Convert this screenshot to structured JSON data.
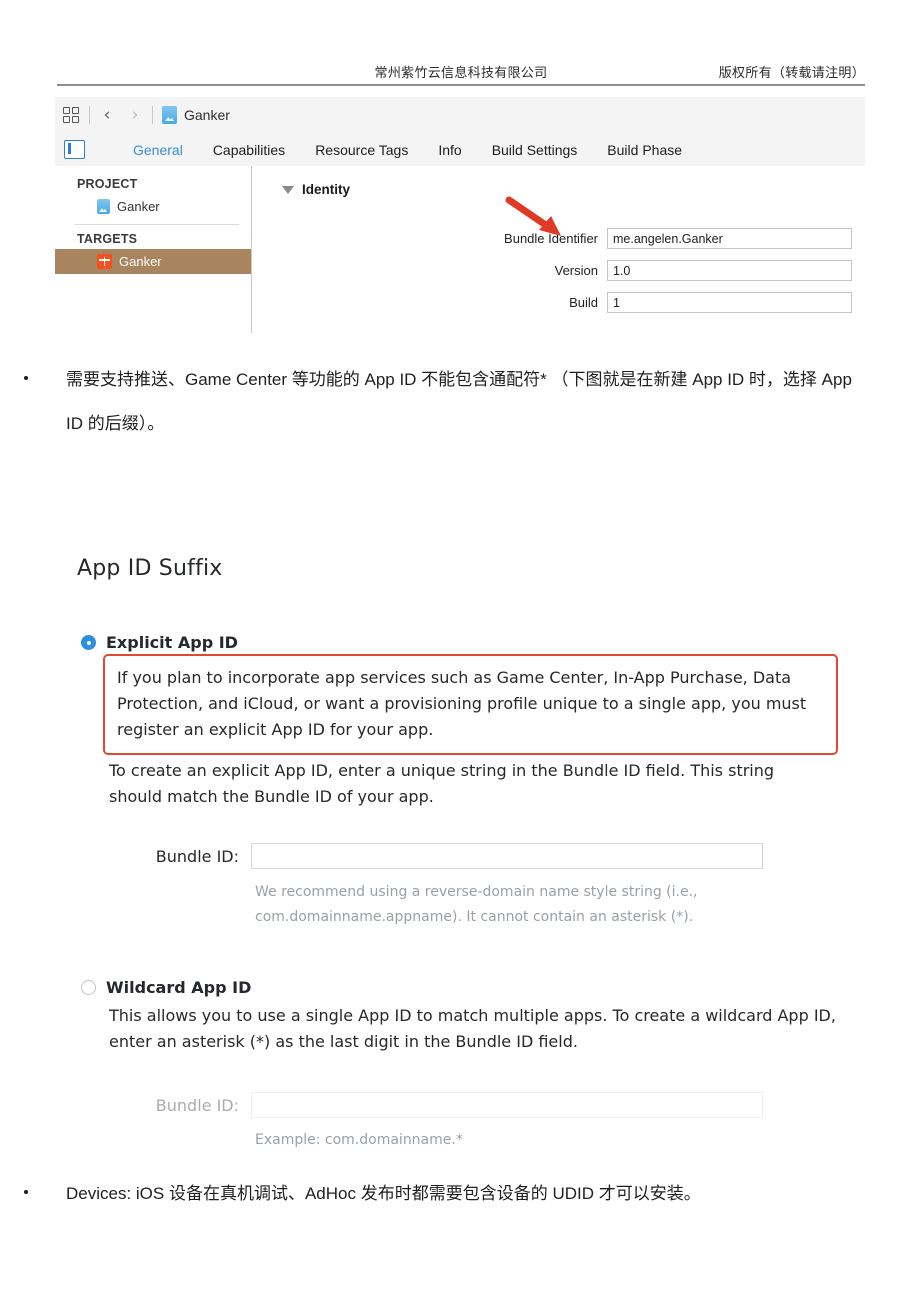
{
  "page_header": {
    "center": "常州紫竹云信息科技有限公司",
    "right": "版权所有（转载请注明）"
  },
  "xcode": {
    "toolbar": {
      "grid_icon": "grid-icon",
      "back_icon": "‹",
      "forward_icon": "›",
      "project_icon": "project-document-icon",
      "project_title": "Ganker"
    },
    "tabbar": {
      "panel_toggle_icon": "navigator-toggle-icon",
      "tabs": [
        {
          "label": "General",
          "active": true
        },
        {
          "label": "Capabilities",
          "active": false
        },
        {
          "label": "Resource Tags",
          "active": false
        },
        {
          "label": "Info",
          "active": false
        },
        {
          "label": "Build Settings",
          "active": false
        },
        {
          "label": "Build Phase",
          "active": false
        }
      ]
    },
    "sidebar": {
      "project_group_label": "PROJECT",
      "project_item": "Ganker",
      "targets_group_label": "TARGETS",
      "target_item": "Ganker"
    },
    "content": {
      "section_title": "Identity",
      "fields": [
        {
          "label": "Bundle Identifier",
          "value": "me.angelen.Ganker"
        },
        {
          "label": "Version",
          "value": "1.0"
        },
        {
          "label": "Build",
          "value": "1"
        }
      ],
      "annotation_arrow_color": "#e03a27"
    }
  },
  "bullets": {
    "game_center": "需要支持推送、Game Center 等功能的 App ID 不能包含通配符* （下图就是在新建 App ID 时，选择 App ID 的后缀）。",
    "devices": "Devices: iOS 设备在真机调试、AdHoc 发布时都需要包含设备的 UDID 才可以安装。"
  },
  "portal": {
    "title": "App ID Suffix",
    "explicit": {
      "radio_state": "selected",
      "label": "Explicit App ID",
      "callout": "If you plan to incorporate app services such as Game Center, In-App Purchase, Data Protection, and iCloud, or want a provisioning profile unique to a single app, you must register an explicit App ID for your app.",
      "callout_border_color": "#e04a32",
      "help": "To create an explicit App ID, enter a unique string in the Bundle ID field. This string should match the Bundle ID of your app.",
      "bundle_label": "Bundle ID:",
      "bundle_value": "",
      "hint": "We recommend using a reverse-domain name style string (i.e., com.domainname.appname). It cannot contain an asterisk (*)."
    },
    "wildcard": {
      "radio_state": "unselected",
      "label": "Wildcard App ID",
      "help": "This allows you to use a single App ID to match multiple apps. To create a wildcard App ID, enter an asterisk (*) as the last digit in the Bundle ID field.",
      "bundle_label": "Bundle ID:",
      "bundle_value": "",
      "hint": "Example: com.domainname.*"
    }
  }
}
